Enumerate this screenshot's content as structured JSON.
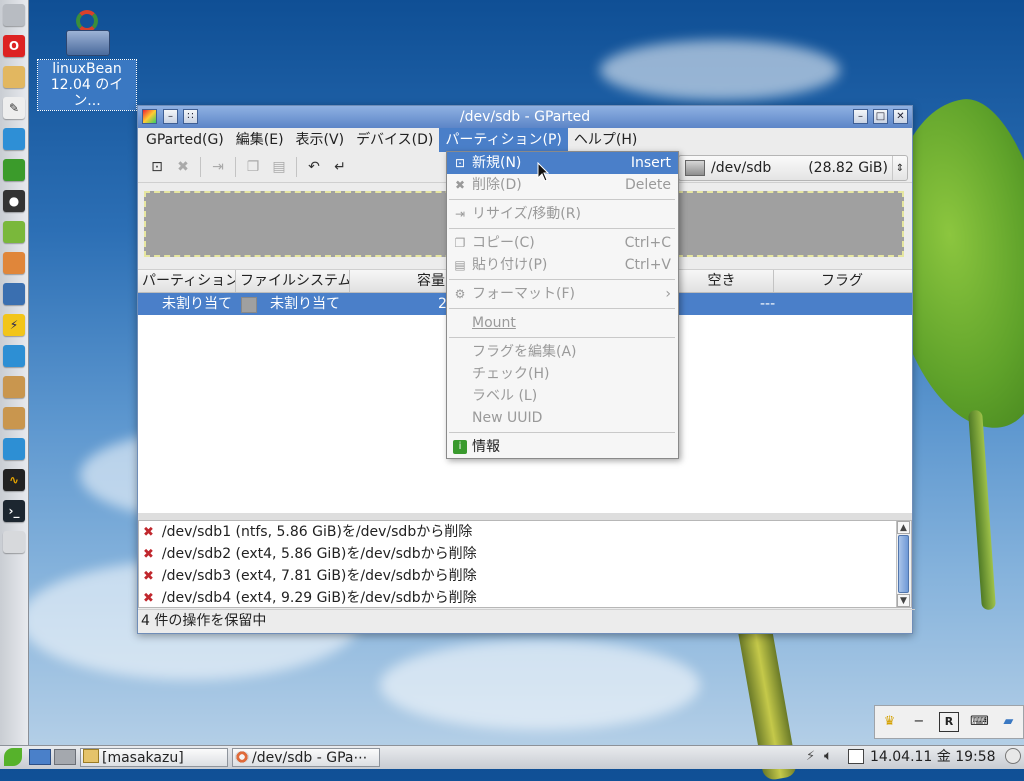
{
  "desktop": {
    "icon_label": "linuxBean\n12.04 のイン..."
  },
  "window": {
    "title": "/dev/sdb - GParted",
    "menu": [
      "GParted(G)",
      "編集(E)",
      "表示(V)",
      "デバイス(D)",
      "パーティション(P)",
      "ヘルプ(H)"
    ],
    "device": {
      "name": "/dev/sdb",
      "size": "(28.82 GiB)"
    },
    "table": {
      "headers": [
        "パーティション",
        "ファイルシステム",
        "容量",
        "空き",
        "フラグ"
      ],
      "row": {
        "partition": "未割り当て",
        "filesystem": "未割り当て",
        "size": "2",
        "free": "---"
      }
    },
    "log": [
      "/dev/sdb1 (ntfs, 5.86 GiB)を/dev/sdbから削除",
      "/dev/sdb2 (ext4, 5.86 GiB)を/dev/sdbから削除",
      "/dev/sdb3 (ext4, 7.81 GiB)を/dev/sdbから削除",
      "/dev/sdb4 (ext4, 9.29 GiB)を/dev/sdbから削除"
    ],
    "status": "4 件の操作を保留中"
  },
  "dropdown": {
    "new": {
      "label": "新規(N)",
      "accel": "Insert"
    },
    "delete": {
      "label": "削除(D)",
      "accel": "Delete"
    },
    "resize": {
      "label": "リサイズ/移動(R)"
    },
    "copy": {
      "label": "コピー(C)",
      "accel": "Ctrl+C"
    },
    "paste": {
      "label": "貼り付け(P)",
      "accel": "Ctrl+V"
    },
    "format": {
      "label": "フォーマット(F)"
    },
    "mount": {
      "label": "Mount"
    },
    "flags": {
      "label": "フラグを編集(A)"
    },
    "check": {
      "label": "チェック(H)"
    },
    "labelitem": {
      "label": "ラベル (L)"
    },
    "uuid": {
      "label": "New UUID"
    },
    "info": {
      "label": "情報"
    }
  },
  "taskbar": {
    "folder": "[masakazu]",
    "gparted": "/dev/sdb - GPa⋯",
    "clock": "14.04.11 金 19:58"
  },
  "colors": {
    "accent": "#4a7fc9",
    "error": "#c0272d"
  }
}
